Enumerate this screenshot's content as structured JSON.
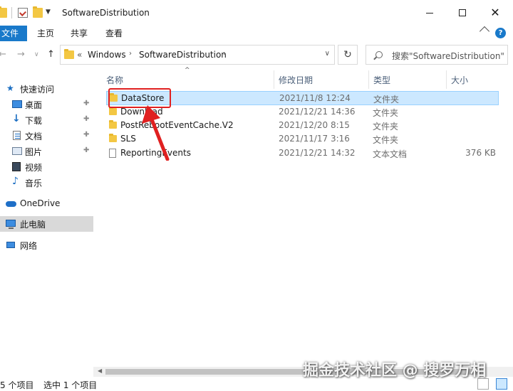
{
  "window": {
    "title": "SoftwareDistribution",
    "minimize_label": "—",
    "maximize_label": "□",
    "close_label": "✕"
  },
  "ribbon": {
    "tabs": [
      "文件",
      "主页",
      "共享",
      "查看"
    ],
    "help_label": "?"
  },
  "nav": {
    "back_label": "←",
    "forward_label": "→",
    "recent_label": "∨",
    "up_label": "↑",
    "address_prefix": "«",
    "address_segments": [
      "Windows",
      "SoftwareDistribution"
    ],
    "refresh_label": "↻",
    "search_placeholder": "搜索\"SoftwareDistribution\""
  },
  "sidebar": {
    "items": [
      {
        "label": "快速访问",
        "icon": "star-icon",
        "pinned": false
      },
      {
        "label": "桌面",
        "icon": "desktop-icon",
        "pinned": true
      },
      {
        "label": "下载",
        "icon": "download-icon",
        "pinned": true
      },
      {
        "label": "文档",
        "icon": "document-icon",
        "pinned": true
      },
      {
        "label": "图片",
        "icon": "pictures-icon",
        "pinned": true
      },
      {
        "label": "视频",
        "icon": "video-icon",
        "pinned": false
      },
      {
        "label": "音乐",
        "icon": "music-icon",
        "pinned": false
      },
      {
        "label": "OneDrive",
        "icon": "onedrive-icon",
        "pinned": false
      },
      {
        "label": "此电脑",
        "icon": "this-pc-icon",
        "pinned": false,
        "selected": true
      },
      {
        "label": "网络",
        "icon": "network-icon",
        "pinned": false
      }
    ]
  },
  "columns": {
    "name": "名称",
    "date": "修改日期",
    "type": "类型",
    "size": "大小"
  },
  "files": [
    {
      "name": "DataStore",
      "date": "2021/11/8 12:24",
      "type": "文件夹",
      "size": "",
      "kind": "folder",
      "selected": true
    },
    {
      "name": "Download",
      "date": "2021/12/21 14:36",
      "type": "文件夹",
      "size": "",
      "kind": "folder"
    },
    {
      "name": "PostRebootEventCache.V2",
      "date": "2021/12/20 8:15",
      "type": "文件夹",
      "size": "",
      "kind": "folder"
    },
    {
      "name": "SLS",
      "date": "2021/11/17 3:16",
      "type": "文件夹",
      "size": "",
      "kind": "folder"
    },
    {
      "name": "ReportingEvents",
      "date": "2021/12/21 14:32",
      "type": "文本文档",
      "size": "376 KB",
      "kind": "file"
    }
  ],
  "status": {
    "item_count": "5 个项目",
    "selected_count": "选中 1 个项目"
  },
  "watermark": "掘金技术社区 @ 搜罗万相",
  "colors": {
    "accent": "#1979ca",
    "selection": "#cce8ff",
    "annotation": "#e02020",
    "folder": "#f3c743"
  }
}
